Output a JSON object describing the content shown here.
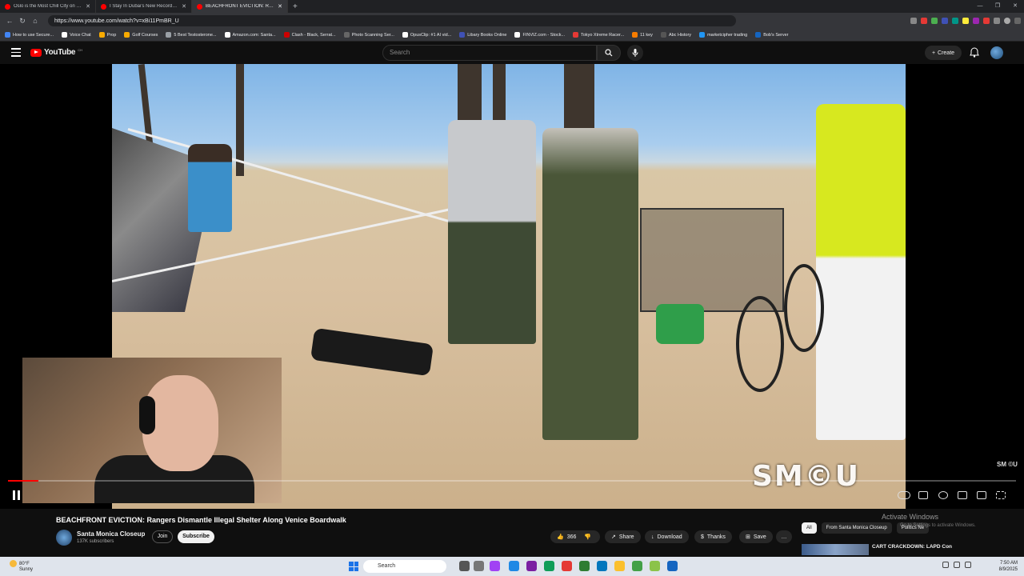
{
  "browser": {
    "tabs": [
      {
        "title": "Oslo is the Most Chill City on Earth",
        "active": false,
        "favicon_color": "#ff0000"
      },
      {
        "title": "I Stay In Dubai's New Record-Breaking",
        "active": false,
        "favicon_color": "#ff0000"
      },
      {
        "title": "BEACHFRONT EVICTION: Rangers",
        "active": true,
        "favicon_color": "#ff0000"
      }
    ],
    "url": "https://www.youtube.com/watch?v=xBi11PmBR_U",
    "bookmarks": [
      "How to use Secure...",
      "Voice Chat",
      "Prop",
      "Golf Courses",
      "5 Best Testosterone...",
      "Amazon.com: Santa...",
      "Clash - Black, Serrat...",
      "Photo Scanning Ser...",
      "OpusClip: #1 AI vid...",
      "Libary Books Online",
      "FINVIZ.com - Stock...",
      "Tokyo Xtreme Racer...",
      "11 key",
      "Abc History",
      "marketcipher trading",
      "Bob's Server"
    ]
  },
  "youtube": {
    "logo_text": "YouTube",
    "country_code": "CH",
    "search_placeholder": "Search",
    "create_label": "Create",
    "video": {
      "title": "BEACHFRONT EVICTION: Rangers Dismantle Illegal Shelter Along Venice Boardwalk",
      "watermark": "SM©U",
      "watermark_small": "SM ©U",
      "progress_fraction": 0.03
    },
    "channel": {
      "name": "Santa Monica Closeup",
      "subscribers": "137K subscribers",
      "join_label": "Join",
      "subscribe_label": "Subscribe"
    },
    "actions": {
      "likes": "366",
      "share": "Share",
      "download": "Download",
      "thanks": "Thanks",
      "save": "Save"
    },
    "chips": [
      "All",
      "From Santa Monica Closeup",
      "Politics Ne"
    ],
    "recommendation": {
      "title": "CART CRACKDOWN: LAPD Confiscates Several Shopping"
    }
  },
  "os": {
    "activate_title": "Activate Windows",
    "activate_sub": "Go to Settings to activate Windows.",
    "weather_temp": "80°F",
    "weather_desc": "Sunny",
    "taskbar_search": "Search",
    "time": "7:50 AM",
    "date": "8/9/2025"
  },
  "colors": {
    "yt_red": "#ff0000",
    "bg": "#0f0f0f"
  }
}
